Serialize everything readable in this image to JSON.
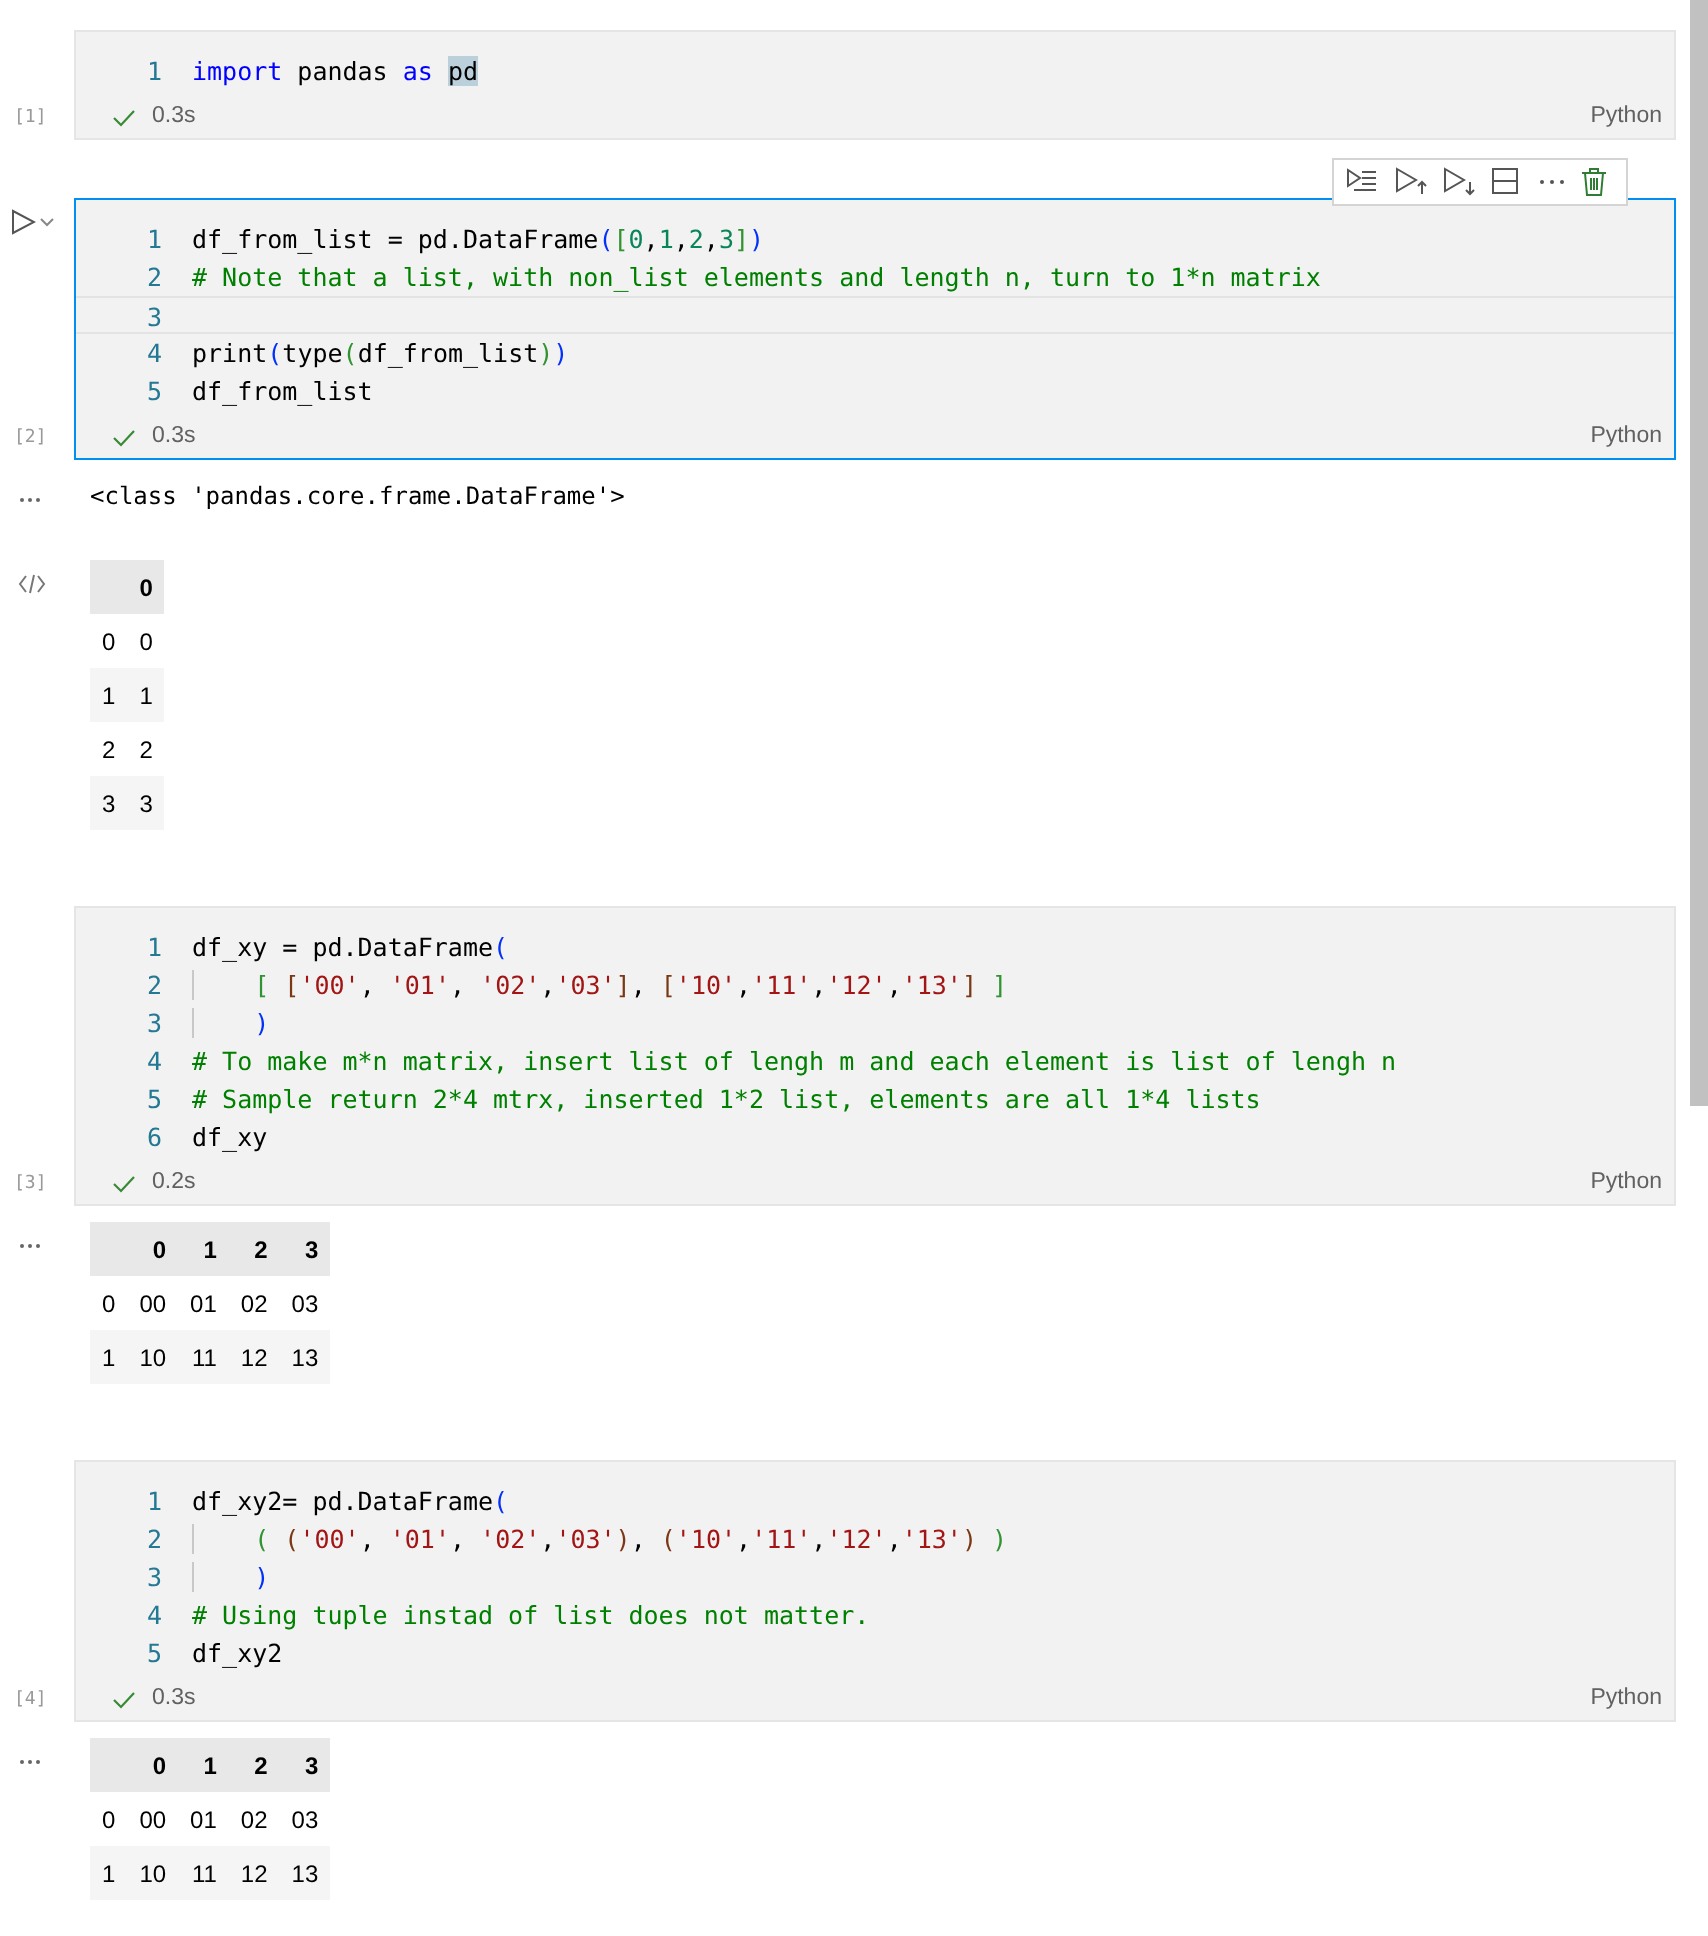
{
  "cells": [
    {
      "execution_count": "[1]",
      "succeeded": true,
      "time": "0.3s",
      "language": "Python",
      "selected": false,
      "lines": [
        {
          "number": "1",
          "current": false,
          "indented": false,
          "tokens": [
            {
              "t": "import",
              "kind": "keyword",
              "highlighted": false
            },
            {
              "t": " pandas ",
              "kind": "name",
              "highlighted": false
            },
            {
              "t": "as ",
              "kind": "keyword",
              "highlighted": false
            },
            {
              "t": "pd",
              "kind": "name",
              "highlighted": true
            }
          ]
        }
      ]
    },
    {
      "execution_count": "[2]",
      "succeeded": true,
      "time": "0.3s",
      "language": "Python",
      "selected": true,
      "lines": [
        {
          "number": "1",
          "current": false,
          "indented": false,
          "tokens": [
            {
              "t": "df_from_list = pd.DataFrame",
              "kind": "name"
            },
            {
              "t": "(",
              "kind": "bracket1"
            },
            {
              "t": "[",
              "kind": "bracket2"
            },
            {
              "t": "0",
              "kind": "number"
            },
            {
              "t": ",",
              "kind": "name"
            },
            {
              "t": "1",
              "kind": "number"
            },
            {
              "t": ",",
              "kind": "name"
            },
            {
              "t": "2",
              "kind": "number"
            },
            {
              "t": ",",
              "kind": "name"
            },
            {
              "t": "3",
              "kind": "number"
            },
            {
              "t": "]",
              "kind": "bracket2"
            },
            {
              "t": ")",
              "kind": "bracket1"
            }
          ]
        },
        {
          "number": "2",
          "current": false,
          "indented": false,
          "tokens": [
            {
              "t": "# Note that a list, with non_list elements and length n, turn to 1*n matrix",
              "kind": "comment"
            }
          ]
        },
        {
          "number": "3",
          "current": true,
          "indented": false
        },
        {
          "number": "4",
          "current": false,
          "indented": false,
          "tokens": [
            {
              "t": "print",
              "kind": "name"
            },
            {
              "t": "(",
              "kind": "bracket1"
            },
            {
              "t": "type",
              "kind": "name"
            },
            {
              "t": "(",
              "kind": "bracket2"
            },
            {
              "t": "df_from_list",
              "kind": "name"
            },
            {
              "t": ")",
              "kind": "bracket2"
            },
            {
              "t": ")",
              "kind": "bracket1"
            }
          ]
        },
        {
          "number": "5",
          "current": false,
          "indented": false,
          "tokens": [
            {
              "t": "df_from_list",
              "kind": "name"
            }
          ]
        }
      ],
      "outputs": [
        {
          "kind": "stream",
          "text": "<class 'pandas.core.frame.DataFrame'>"
        },
        {
          "kind": "table",
          "columns": [
            "0"
          ],
          "rows": [
            {
              "index": "0",
              "cells": [
                "0"
              ]
            },
            {
              "index": "1",
              "cells": [
                "1"
              ]
            },
            {
              "index": "2",
              "cells": [
                "2"
              ]
            },
            {
              "index": "3",
              "cells": [
                "3"
              ]
            }
          ]
        }
      ]
    },
    {
      "execution_count": "[3]",
      "succeeded": true,
      "time": "0.2s",
      "language": "Python",
      "selected": false,
      "lines": [
        {
          "number": "1",
          "current": false,
          "indented": false,
          "tokens": [
            {
              "t": "df_xy = pd.DataFrame",
              "kind": "name"
            },
            {
              "t": "(",
              "kind": "bracket1"
            }
          ]
        },
        {
          "number": "2",
          "current": false,
          "indented": true,
          "tokens": [
            {
              "t": "[",
              "kind": "bracket2"
            },
            {
              "t": " [",
              "kind": "bracket3"
            },
            {
              "t": "'00'",
              "kind": "string"
            },
            {
              "t": ", ",
              "kind": "name"
            },
            {
              "t": "'01'",
              "kind": "string"
            },
            {
              "t": ", ",
              "kind": "name"
            },
            {
              "t": "'02'",
              "kind": "string"
            },
            {
              "t": ",",
              "kind": "name"
            },
            {
              "t": "'03'",
              "kind": "string"
            },
            {
              "t": "]",
              "kind": "bracket3"
            },
            {
              "t": ", ",
              "kind": "name"
            },
            {
              "t": "[",
              "kind": "bracket3"
            },
            {
              "t": "'10'",
              "kind": "string"
            },
            {
              "t": ",",
              "kind": "name"
            },
            {
              "t": "'11'",
              "kind": "string"
            },
            {
              "t": ",",
              "kind": "name"
            },
            {
              "t": "'12'",
              "kind": "string"
            },
            {
              "t": ",",
              "kind": "name"
            },
            {
              "t": "'13'",
              "kind": "string"
            },
            {
              "t": "]",
              "kind": "bracket3"
            },
            {
              "t": " ]",
              "kind": "bracket2"
            }
          ]
        },
        {
          "number": "3",
          "current": false,
          "indented": true,
          "tokens": [
            {
              "t": ")",
              "kind": "bracket1"
            }
          ]
        },
        {
          "number": "4",
          "current": false,
          "indented": false,
          "tokens": [
            {
              "t": "# To make m*n matrix, insert list of lengh m and each element is list of lengh n",
              "kind": "comment"
            }
          ]
        },
        {
          "number": "5",
          "current": false,
          "indented": false,
          "tokens": [
            {
              "t": "# Sample return 2*4 mtrx, inserted 1*2 list, elements are all 1*4 lists",
              "kind": "comment"
            }
          ]
        },
        {
          "number": "6",
          "current": false,
          "indented": false,
          "tokens": [
            {
              "t": "df_xy",
              "kind": "name"
            }
          ]
        }
      ],
      "outputs": [
        {
          "kind": "table",
          "columns": [
            "0",
            "1",
            "2",
            "3"
          ],
          "rows": [
            {
              "index": "0",
              "cells": [
                "00",
                "01",
                "02",
                "03"
              ]
            },
            {
              "index": "1",
              "cells": [
                "10",
                "11",
                "12",
                "13"
              ]
            }
          ]
        }
      ]
    },
    {
      "execution_count": "[4]",
      "succeeded": true,
      "time": "0.3s",
      "language": "Python",
      "selected": false,
      "lines": [
        {
          "number": "1",
          "current": false,
          "indented": false,
          "tokens": [
            {
              "t": "df_xy2= pd.DataFrame",
              "kind": "name"
            },
            {
              "t": "(",
              "kind": "bracket1"
            }
          ]
        },
        {
          "number": "2",
          "current": false,
          "indented": true,
          "tokens": [
            {
              "t": "(",
              "kind": "bracket2"
            },
            {
              "t": " (",
              "kind": "bracket3"
            },
            {
              "t": "'00'",
              "kind": "string"
            },
            {
              "t": ", ",
              "kind": "name"
            },
            {
              "t": "'01'",
              "kind": "string"
            },
            {
              "t": ", ",
              "kind": "name"
            },
            {
              "t": "'02'",
              "kind": "string"
            },
            {
              "t": ",",
              "kind": "name"
            },
            {
              "t": "'03'",
              "kind": "string"
            },
            {
              "t": ")",
              "kind": "bracket3"
            },
            {
              "t": ", ",
              "kind": "name"
            },
            {
              "t": "(",
              "kind": "bracket3"
            },
            {
              "t": "'10'",
              "kind": "string"
            },
            {
              "t": ",",
              "kind": "name"
            },
            {
              "t": "'11'",
              "kind": "string"
            },
            {
              "t": ",",
              "kind": "name"
            },
            {
              "t": "'12'",
              "kind": "string"
            },
            {
              "t": ",",
              "kind": "name"
            },
            {
              "t": "'13'",
              "kind": "string"
            },
            {
              "t": ")",
              "kind": "bracket3"
            },
            {
              "t": " )",
              "kind": "bracket2"
            }
          ]
        },
        {
          "number": "3",
          "current": false,
          "indented": true,
          "tokens": [
            {
              "t": ")",
              "kind": "bracket1"
            }
          ]
        },
        {
          "number": "4",
          "current": false,
          "indented": false,
          "tokens": [
            {
              "t": "# Using tuple instad of list does not matter.",
              "kind": "comment"
            }
          ]
        },
        {
          "number": "5",
          "current": false,
          "indented": false,
          "tokens": [
            {
              "t": "df_xy2",
              "kind": "name"
            }
          ]
        }
      ],
      "outputs": [
        {
          "kind": "table",
          "columns": [
            "0",
            "1",
            "2",
            "3"
          ],
          "rows": [
            {
              "index": "0",
              "cells": [
                "00",
                "01",
                "02",
                "03"
              ]
            },
            {
              "index": "1",
              "cells": [
                "10",
                "11",
                "12",
                "13"
              ]
            }
          ]
        }
      ]
    }
  ]
}
